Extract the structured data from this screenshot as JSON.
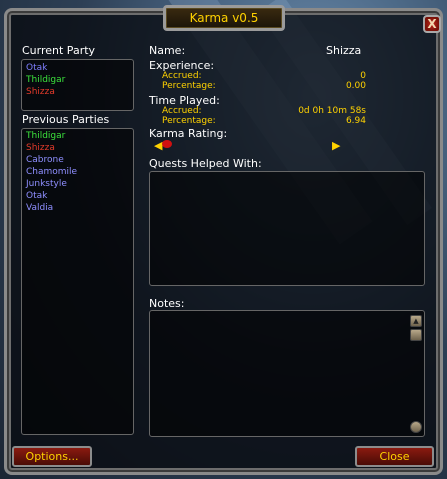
{
  "window": {
    "title": "Karma v0.5",
    "close_label": "X"
  },
  "current_party": {
    "heading": "Current Party",
    "members": [
      {
        "name": "Otak",
        "color": "#7f7fff"
      },
      {
        "name": "Thildigar",
        "color": "#3ce23c"
      },
      {
        "name": "Shizza",
        "color": "#e23a2a"
      }
    ]
  },
  "previous_parties": {
    "heading": "Previous Parties",
    "members": [
      {
        "name": "Thildigar",
        "color": "#3ce23c"
      },
      {
        "name": "Shizza",
        "color": "#e23a2a"
      },
      {
        "name": "Cabrone",
        "color": "#8f8fff"
      },
      {
        "name": "Chamomile",
        "color": "#8f8fff"
      },
      {
        "name": "Junkstyle",
        "color": "#8f8fff"
      },
      {
        "name": "Otak",
        "color": "#8f8fff"
      },
      {
        "name": "Valdia",
        "color": "#8f8fff"
      }
    ]
  },
  "details": {
    "name_label": "Name:",
    "name_value": "Shizza",
    "experience_label": "Experience:",
    "exp_accrued_label": "Accrued:",
    "exp_accrued_value": "0",
    "exp_percentage_label": "Percentage:",
    "exp_percentage_value": "0.00",
    "time_label": "Time Played:",
    "time_accrued_label": "Accrued:",
    "time_accrued_value": "0d 0h 10m 58s",
    "time_percentage_label": "Percentage:",
    "time_percentage_value": "6.94",
    "karma_label": "Karma Rating:",
    "quests_label": "Quests Helped With:",
    "notes_label": "Notes:"
  },
  "buttons": {
    "options": "Options...",
    "close": "Close"
  },
  "colors": {
    "accent_gold": "#ffd200",
    "button_red": "#7a1a10"
  }
}
